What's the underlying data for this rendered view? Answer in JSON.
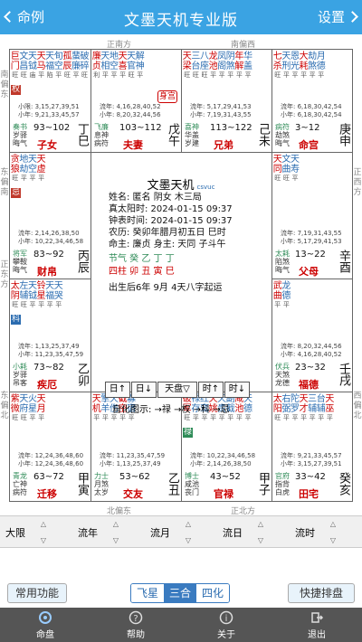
{
  "topbar": {
    "back": "命例",
    "title": "文墨天机专业版",
    "settings": "设置"
  },
  "directions": {
    "top_left": "正南方",
    "top_right": "南偏西",
    "left_top": "南偏东",
    "left_mid": "东偏南",
    "left_low": "正东方",
    "left_bottom": "东偏北",
    "right_top": "正西方",
    "right_mid": "西偏北",
    "right_bottom": "正北方",
    "bottom_left": "北偏东",
    "bottom_right": "正北方"
  },
  "palaces": [
    {
      "stars": [
        [
          "巨",
          "旺"
        ],
        [
          "文",
          "旺"
        ],
        [
          "天",
          "庙"
        ],
        [
          "天",
          "平"
        ],
        [
          "天",
          "陷"
        ],
        [
          "旬",
          "平"
        ],
        [
          "孤",
          "旺"
        ],
        [
          "蜚",
          "平"
        ],
        [
          "破",
          "旺"
        ]
      ],
      "stars2": [
        "门",
        "昌",
        "钺",
        "马",
        "福",
        "空",
        "辰",
        "廉",
        "碎"
      ],
      "hua": "权",
      "ages": [
        "小限: 3,15,27,39,51",
        "小年: 9,21,33,45,57"
      ],
      "lows": [
        "奏书",
        "岁驿",
        "晦气"
      ],
      "range": "93~102",
      "pal": "子女",
      "gz": "丁巳"
    },
    {
      "stars": [
        [
          "廉",
          "利"
        ],
        [
          "天",
          "平"
        ],
        [
          "地",
          "平"
        ],
        [
          "天",
          "平"
        ],
        [
          "天",
          "旺"
        ],
        [
          "解",
          "平"
        ]
      ],
      "stars2": [
        "贞",
        "相",
        "空",
        "喜",
        "官",
        "神"
      ],
      "ages": [
        "流年: 4,16,28,40,52",
        "小年: 8,20,32,44,56"
      ],
      "lows": [
        "飞廉",
        "息神",
        "病符"
      ],
      "range": "103~112",
      "pal": "夫妻",
      "gz": "戊午",
      "badge": "身宫"
    },
    {
      "stars": [
        [
          "天",
          "旺"
        ],
        [
          "三",
          "旺"
        ],
        [
          "八",
          "旺"
        ],
        [
          "龙",
          "平"
        ],
        [
          "凤",
          "平"
        ],
        [
          "阴",
          "平"
        ],
        [
          "年",
          "平"
        ],
        [
          "华",
          "平"
        ]
      ],
      "stars2": [
        "梁",
        "台",
        "座",
        "池",
        "阁",
        "煞",
        "解",
        "盖"
      ],
      "ages": [
        "流年: 5,17,29,41,53",
        "小年: 7,19,31,43,55"
      ],
      "lows": [
        "喜神",
        "华盖",
        "岁建"
      ],
      "range": "113~122",
      "pal": "兄弟",
      "gz": "己未"
    },
    {
      "stars": [
        [
          "七",
          "旺"
        ],
        [
          "天",
          "平"
        ],
        [
          "恩",
          "平"
        ],
        [
          "大",
          "平"
        ],
        [
          "劫",
          "平"
        ],
        [
          "月",
          "平"
        ]
      ],
      "stars2": [
        "杀",
        "刑",
        "光",
        "耗",
        "煞",
        "德"
      ],
      "ages": [
        "流年: 6,18,30,42,54",
        "小年: 6,18,30,42,54"
      ],
      "lows": [
        "病符",
        "劫煞",
        "晦气"
      ],
      "range": "3~12",
      "pal": "命宫",
      "gz": "庚申"
    },
    {
      "stars": [
        [
          "贪",
          "旺"
        ],
        [
          "地",
          "平"
        ],
        [
          "天",
          "平"
        ],
        [
          "天",
          "平"
        ]
      ],
      "stars2": [
        "狼",
        "劫",
        "空",
        "虚"
      ],
      "hua": "忌",
      "ages": [
        "流年: 2,14,26,38,50",
        "小年: 10,22,34,46,58"
      ],
      "lows": [
        "将军",
        "攀鞍",
        "晦气"
      ],
      "range": "83~92",
      "pal": "财帛",
      "gz": "丙辰"
    },
    {
      "stars": [
        [
          "天",
          "旺"
        ],
        [
          "文",
          "旺"
        ],
        [
          "天",
          "平"
        ]
      ],
      "stars2": [
        "同",
        "曲",
        "寿"
      ],
      "ages": [
        "流年: 7,19,31,43,55",
        "小年: 5,17,29,41,53"
      ],
      "lows": [
        "太耗",
        "陷煞",
        "晦气"
      ],
      "range": "13~22",
      "pal": "父母",
      "gz": "辛酉"
    },
    {
      "stars": [
        [
          "太",
          "旺"
        ],
        [
          "左",
          "旺"
        ],
        [
          "天",
          "平"
        ],
        [
          "铃",
          "平"
        ],
        [
          "天",
          "平"
        ],
        [
          "天",
          "平"
        ]
      ],
      "stars2": [
        "阴",
        "辅",
        "钺",
        "星",
        "福",
        "哭"
      ],
      "hua": "科",
      "ages": [
        "流年: 1,13,25,37,49",
        "小年: 11,23,35,47,59"
      ],
      "lows": [
        "小耗",
        "岁驿",
        "吊客"
      ],
      "range": "73~82",
      "pal": "疾厄",
      "gz": "乙卯"
    },
    {
      "stars": [
        [
          "武",
          "平"
        ],
        [
          "龙",
          "平"
        ]
      ],
      "stars2": [
        "曲",
        "德"
      ],
      "ages": [
        "流年: 8,20,32,44,56",
        "小年: 4,16,28,40,52"
      ],
      "lows": [
        "伏兵",
        "天煞",
        "龙德"
      ],
      "range": "23~32",
      "pal": "福德",
      "gz": "壬戌"
    },
    {
      "stars": [
        [
          "紫",
          "旺"
        ],
        [
          "天",
          "旺"
        ],
        [
          "火",
          "平"
        ],
        [
          "天",
          "平"
        ]
      ],
      "stars2": [
        "微",
        "府",
        "星",
        "月"
      ],
      "ages": [
        "流年: 12,24,36,48,60",
        "小年: 12,24,36,48,60"
      ],
      "lows": [
        "青龙",
        "亡神",
        "病符"
      ],
      "range": "63~72",
      "pal": "迁移",
      "gz": "甲寅"
    },
    {
      "stars": [
        [
          "天",
          "平"
        ],
        [
          "擎",
          "平"
        ],
        [
          "天",
          "平"
        ],
        [
          "截",
          "平"
        ],
        [
          "寡",
          "平"
        ]
      ],
      "stars2": [
        "机",
        "羊",
        "伤",
        "空",
        "宿"
      ],
      "ages": [
        "流年: 11,23,35,47,59",
        "小年: 1,13,25,37,49"
      ],
      "lows": [
        "力士",
        "月煞",
        "太岁"
      ],
      "range": "53~62",
      "pal": "交友",
      "gz": "乙丑"
    },
    {
      "stars": [
        [
          "破",
          "旺"
        ],
        [
          "禄",
          "平"
        ],
        [
          "红",
          "平"
        ],
        [
          "天",
          "平"
        ],
        [
          "天",
          "平"
        ],
        [
          "副",
          "平"
        ],
        [
          "咸",
          "平"
        ],
        [
          "天",
          "平"
        ]
      ],
      "stars2": [
        "军",
        "存",
        "鸾",
        "姚",
        "贵",
        "截",
        "池",
        "德"
      ],
      "hua": "禄",
      "ages": [
        "流年: 10,22,34,46,58",
        "小年: 2,14,26,38,50"
      ],
      "lows": [
        "博士",
        "咸池",
        "丧门"
      ],
      "range": "43~52",
      "pal": "官禄",
      "gz": "甲子"
    },
    {
      "stars": [
        [
          "太",
          "旺"
        ],
        [
          "右",
          "平"
        ],
        [
          "陀",
          "平"
        ],
        [
          "天",
          "平"
        ],
        [
          "三",
          "平"
        ],
        [
          "台",
          "平"
        ],
        [
          "天",
          "平"
        ]
      ],
      "stars2": [
        "阳",
        "弼",
        "罗",
        "才",
        "辅",
        "辅",
        "巫"
      ],
      "ages": [
        "流年: 9,21,33,45,57",
        "小年: 3,15,27,39,51"
      ],
      "lows": [
        "官府",
        "指背",
        "白虎"
      ],
      "range": "33~42",
      "pal": "田宅",
      "gz": "癸亥"
    }
  ],
  "center": {
    "title": "文墨天机",
    "ver": "csvuc",
    "lines": [
      "姓名: 匿名  阴女 木三局",
      "真太阳时: 2024-01-15 09:37",
      "钟表时间: 2024-01-15 09:37",
      "农历: 癸卯年腊月初五日 巳时",
      "命主: 廉贞 身主: 天同 子斗午",
      "节气  癸   乙   丁   丁",
      "四柱  卯   丑   寅   巳",
      "出生后6年 9月 4天八字起运"
    ],
    "buttons": [
      "日↑",
      "日↓",
      "天盘▽",
      "时↑",
      "时↓"
    ],
    "legend": "自化图示: →禄 →权 →科 →忌"
  },
  "bottom": {
    "limits": [
      "大限",
      "流年",
      "流月",
      "流日",
      "流时"
    ]
  },
  "funcs": {
    "common": "常用功能",
    "seg": [
      "飞星",
      "三合",
      "四化"
    ],
    "quick": "快捷排盘"
  },
  "tabs": [
    "命盘",
    "帮助",
    "关于",
    "退出"
  ]
}
